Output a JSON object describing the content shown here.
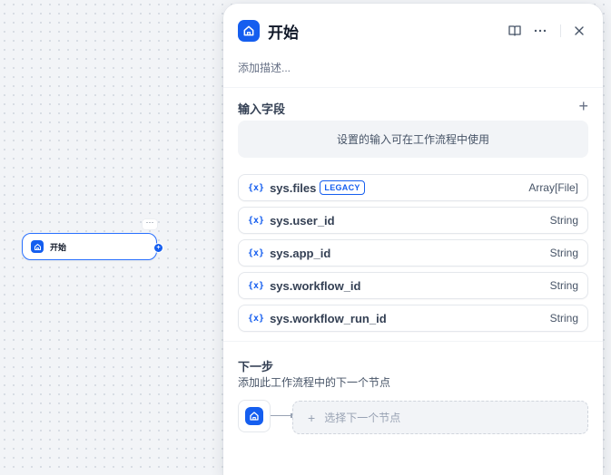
{
  "canvas": {
    "node": {
      "label": "开始",
      "icon": "home-icon",
      "more": "···",
      "handle": "+"
    }
  },
  "panel": {
    "title": "开始",
    "icon": "home-icon",
    "actions": [
      "book-icon",
      "more-icon",
      "close-icon"
    ],
    "description_placeholder": "添加描述...",
    "input_section": {
      "title": "输入字段",
      "add_label": "+",
      "hint": "设置的输入可在工作流程中使用",
      "variables": [
        {
          "icon": "{x}",
          "name": "sys.files",
          "badge": "LEGACY",
          "type": "Array[File]"
        },
        {
          "icon": "{x}",
          "name": "sys.user_id",
          "badge": null,
          "type": "String"
        },
        {
          "icon": "{x}",
          "name": "sys.app_id",
          "badge": null,
          "type": "String"
        },
        {
          "icon": "{x}",
          "name": "sys.workflow_id",
          "badge": null,
          "type": "String"
        },
        {
          "icon": "{x}",
          "name": "sys.workflow_run_id",
          "badge": null,
          "type": "String"
        }
      ]
    },
    "next_section": {
      "title": "下一步",
      "description": "添加此工作流程中的下一个节点",
      "select_label": "选择下一个节点",
      "select_plus": "+"
    }
  },
  "colors": {
    "accent": "#155eef",
    "border": "#e4e7ec",
    "muted": "#667085"
  }
}
